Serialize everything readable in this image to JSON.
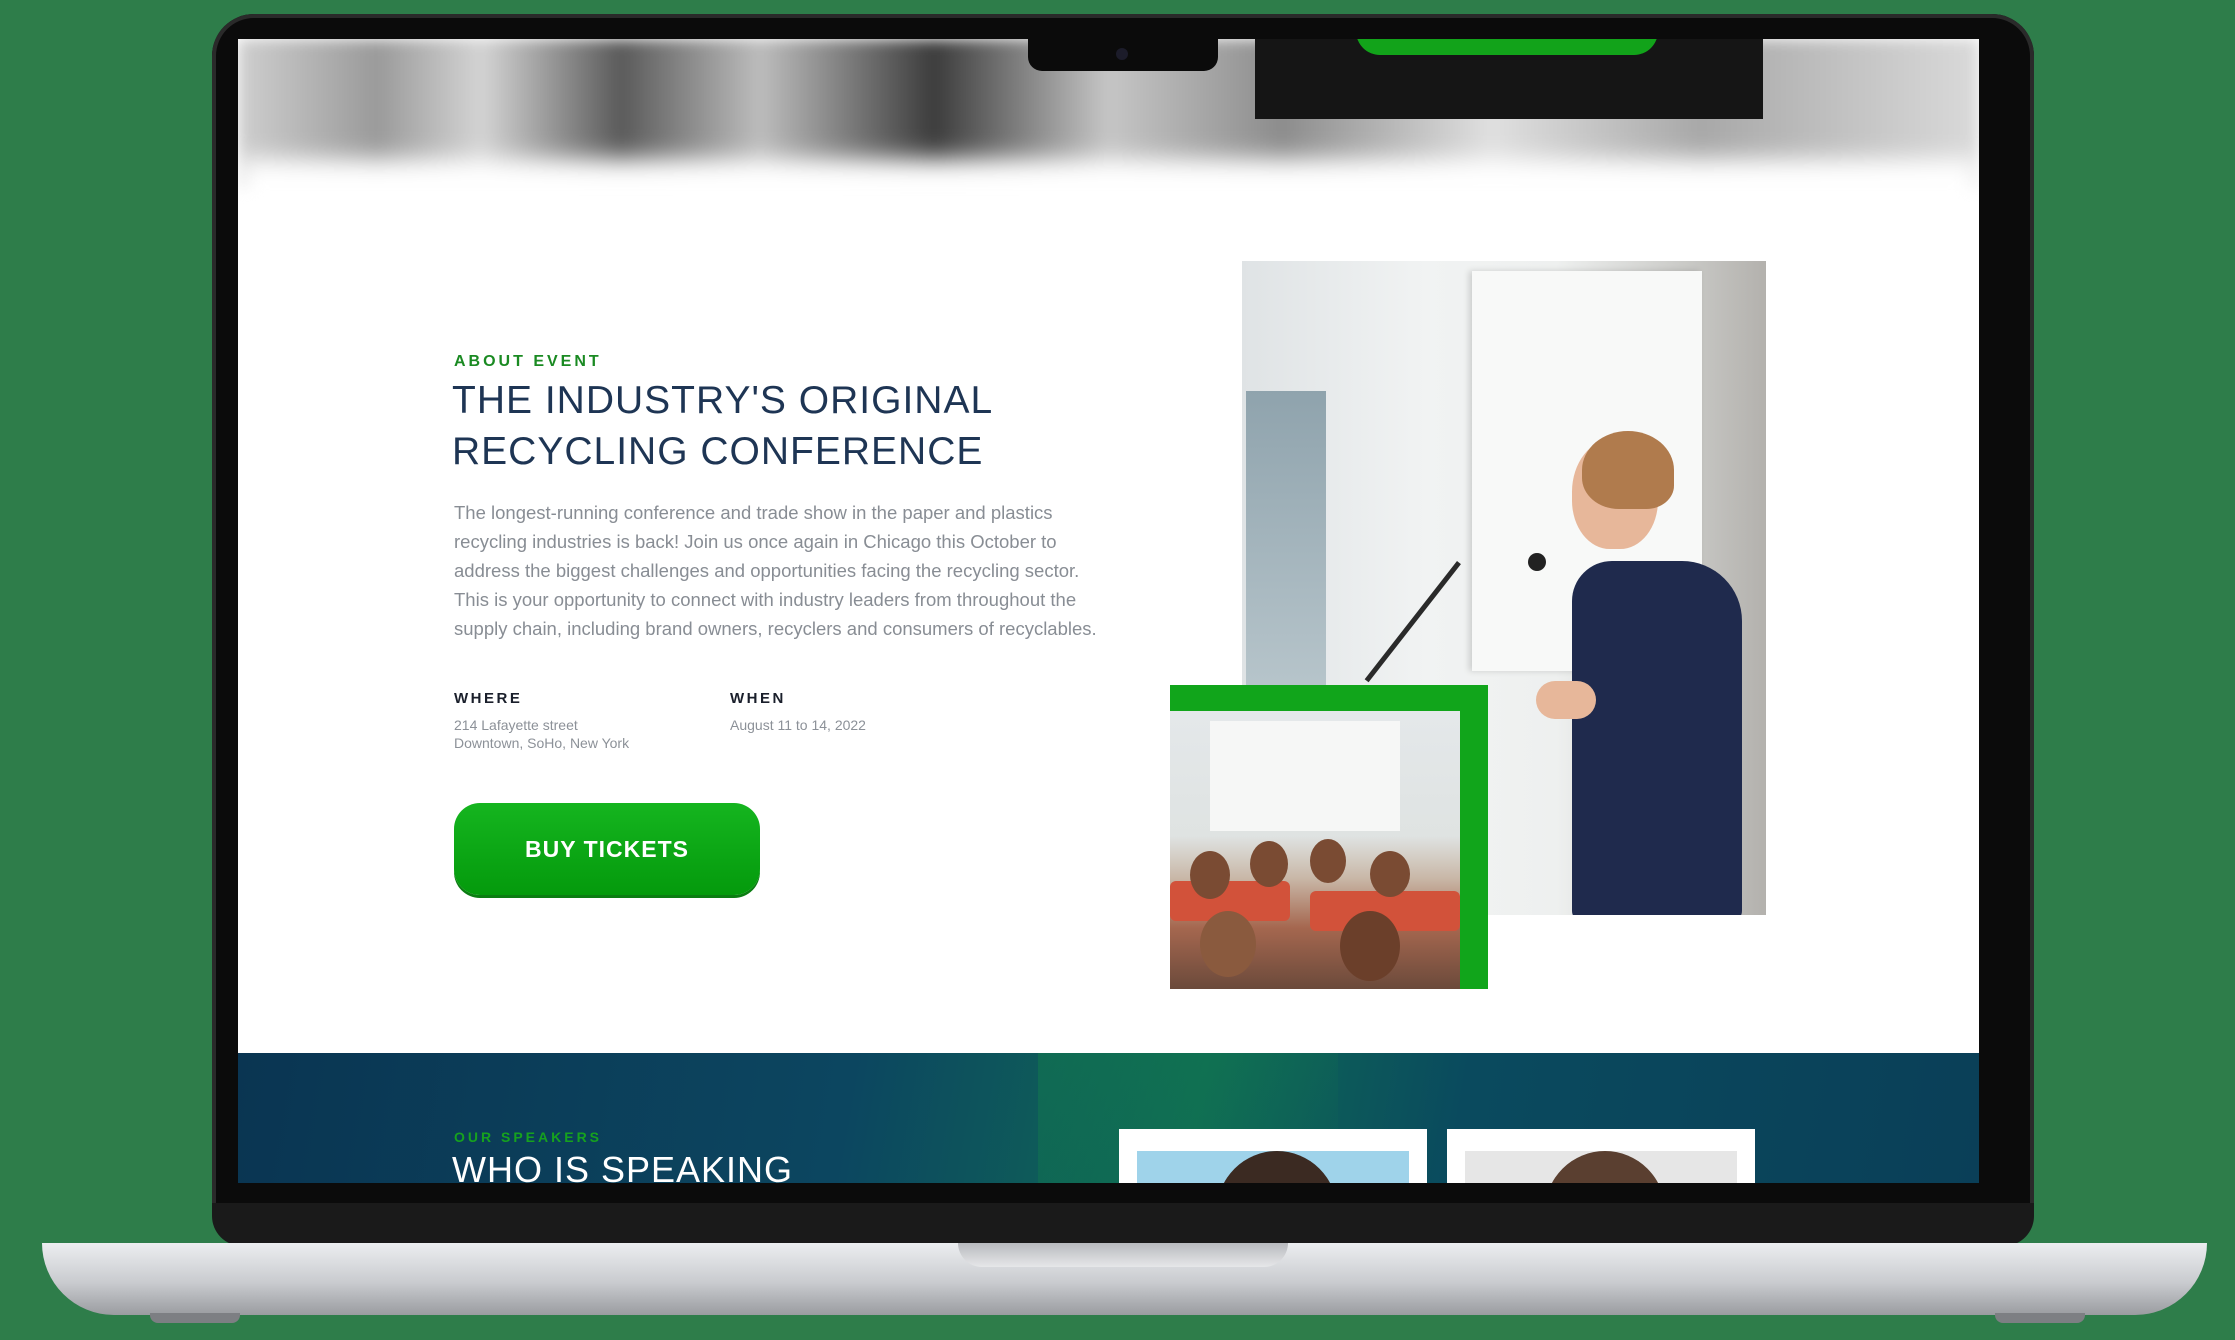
{
  "about": {
    "eyebrow": "ABOUT EVENT",
    "title_line1": "THE INDUSTRY'S ORIGINAL",
    "title_line2": "RECYCLING CONFERENCE",
    "description": "The longest-running conference and trade show in the paper and plastics recycling industries is back! Join us once again in Chicago this October to address the biggest challenges and opportunities facing the recycling sector. This is your opportunity to connect with industry leaders from throughout the supply chain, including brand owners, recyclers and consumers of recyclables.",
    "where_label": "WHERE",
    "where_value": "214 Lafayette street\nDowntown, SoHo, New York",
    "when_label": "WHEN",
    "when_value": "August 11 to 14, 2022",
    "button_label": "BUY TICKETS"
  },
  "speakers": {
    "eyebrow": "OUR SPEAKERS",
    "title": "WHO IS SPEAKING"
  },
  "colors": {
    "accent_green": "#0aa414",
    "heading_navy": "#1e3554",
    "body_gray": "#888d94",
    "speakers_bg": "#0c4660"
  },
  "images": {
    "main_photo": "woman-speaker-at-podium-photo",
    "inset_photo": "conference-audience-photo"
  }
}
